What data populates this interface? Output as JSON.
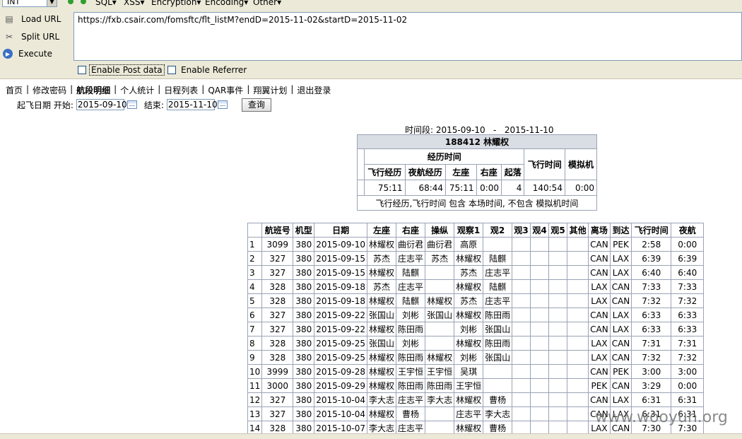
{
  "toolbar": {
    "select_value": "INT",
    "menus": [
      "SQL▾",
      "XSS▾",
      "Encryption▾",
      "Encoding▾",
      "Other▾"
    ],
    "load_url": "Load URL",
    "split_url": "Split URL",
    "execute": "Execute",
    "url": "https://fxb.csair.com/fomsftc/flt_listM?endD=2015-11-02&startD=2015-11-02",
    "enable_post": "Enable Post data",
    "enable_referrer": "Enable Referrer"
  },
  "nav": {
    "items": [
      "首页",
      "修改密码",
      "航段明细",
      "个人统计",
      "日程列表",
      "QAR事件",
      "翔翼计划",
      "退出登录"
    ],
    "sep": "|"
  },
  "search": {
    "label": "起飞日期 开始:",
    "start": "2015-09-10",
    "end_label": "结束:",
    "end": "2015-11-10",
    "button": "查询"
  },
  "summary": {
    "period": "时间段: 2015-09-10   -   2015-11-10",
    "title": "188412 林耀权",
    "group_header": "经历时间",
    "headers": [
      "飞行经历",
      "夜航经历",
      "左座",
      "右座",
      "起落"
    ],
    "flight_time_header": "飞行时间",
    "simulator_header": "模拟机",
    "values": [
      "75:11",
      "68:44",
      "75:11",
      "0:00",
      "4"
    ],
    "flight_time": "140:54",
    "simulator": "0:00",
    "note": "飞行经历,飞行时间 包含 本场时间, 不包含 模拟机时间"
  },
  "flights": {
    "headers": [
      "",
      "航班号",
      "机型",
      "日期",
      "左座",
      "右座",
      "操纵",
      "观察1",
      "观2",
      "观3",
      "观4",
      "观5",
      "其他",
      "离场",
      "到达",
      "飞行时间",
      "夜航"
    ],
    "rows": [
      [
        "1",
        "3099",
        "380",
        "2015-09-10",
        "林耀权",
        "曲衍君",
        "曲衍君",
        "高原",
        "",
        "",
        "",
        "",
        "",
        "CAN",
        "PEK",
        "2:58",
        "0:00"
      ],
      [
        "2",
        "327",
        "380",
        "2015-09-15",
        "苏杰",
        "庄志平",
        "苏杰",
        "林耀权",
        "陆麒",
        "",
        "",
        "",
        "",
        "CAN",
        "LAX",
        "6:39",
        "6:39"
      ],
      [
        "3",
        "327",
        "380",
        "2015-09-15",
        "林耀权",
        "陆麒",
        "",
        "苏杰",
        "庄志平",
        "",
        "",
        "",
        "",
        "CAN",
        "LAX",
        "6:40",
        "6:40"
      ],
      [
        "4",
        "328",
        "380",
        "2015-09-18",
        "苏杰",
        "庄志平",
        "",
        "林耀权",
        "陆麒",
        "",
        "",
        "",
        "",
        "LAX",
        "CAN",
        "7:33",
        "7:33"
      ],
      [
        "5",
        "328",
        "380",
        "2015-09-18",
        "林耀权",
        "陆麒",
        "林耀权",
        "苏杰",
        "庄志平",
        "",
        "",
        "",
        "",
        "LAX",
        "CAN",
        "7:32",
        "7:32"
      ],
      [
        "6",
        "327",
        "380",
        "2015-09-22",
        "张国山",
        "刘彬",
        "张国山",
        "林耀权",
        "陈田雨",
        "",
        "",
        "",
        "",
        "CAN",
        "LAX",
        "6:33",
        "6:33"
      ],
      [
        "7",
        "327",
        "380",
        "2015-09-22",
        "林耀权",
        "陈田雨",
        "",
        "刘彬",
        "张国山",
        "",
        "",
        "",
        "",
        "CAN",
        "LAX",
        "6:33",
        "6:33"
      ],
      [
        "8",
        "328",
        "380",
        "2015-09-25",
        "张国山",
        "刘彬",
        "",
        "林耀权",
        "陈田雨",
        "",
        "",
        "",
        "",
        "LAX",
        "CAN",
        "7:31",
        "7:31"
      ],
      [
        "9",
        "328",
        "380",
        "2015-09-25",
        "林耀权",
        "陈田雨",
        "林耀权",
        "刘彬",
        "张国山",
        "",
        "",
        "",
        "",
        "LAX",
        "CAN",
        "7:32",
        "7:32"
      ],
      [
        "10",
        "3999",
        "380",
        "2015-09-28",
        "林耀权",
        "王宇恒",
        "王宇恒",
        "吴琪",
        "",
        "",
        "",
        "",
        "",
        "CAN",
        "PEK",
        "3:00",
        "3:00"
      ],
      [
        "11",
        "3000",
        "380",
        "2015-09-29",
        "林耀权",
        "陈田雨",
        "陈田雨",
        "王宇恒",
        "",
        "",
        "",
        "",
        "",
        "PEK",
        "CAN",
        "3:29",
        "0:00"
      ],
      [
        "12",
        "327",
        "380",
        "2015-10-04",
        "李大志",
        "庄志平",
        "李大志",
        "林耀权",
        "曹杨",
        "",
        "",
        "",
        "",
        "CAN",
        "LAX",
        "6:31",
        "6:31"
      ],
      [
        "13",
        "327",
        "380",
        "2015-10-04",
        "林耀权",
        "曹杨",
        "",
        "庄志平",
        "李大志",
        "",
        "",
        "",
        "",
        "CAN",
        "LAX",
        "6:31",
        "6:31"
      ],
      [
        "14",
        "328",
        "380",
        "2015-10-07",
        "李大志",
        "庄志平",
        "",
        "林耀权",
        "曹杨",
        "",
        "",
        "",
        "",
        "LAX",
        "CAN",
        "7:30",
        "7:30"
      ]
    ]
  },
  "watermark": "www.wooyun.org"
}
